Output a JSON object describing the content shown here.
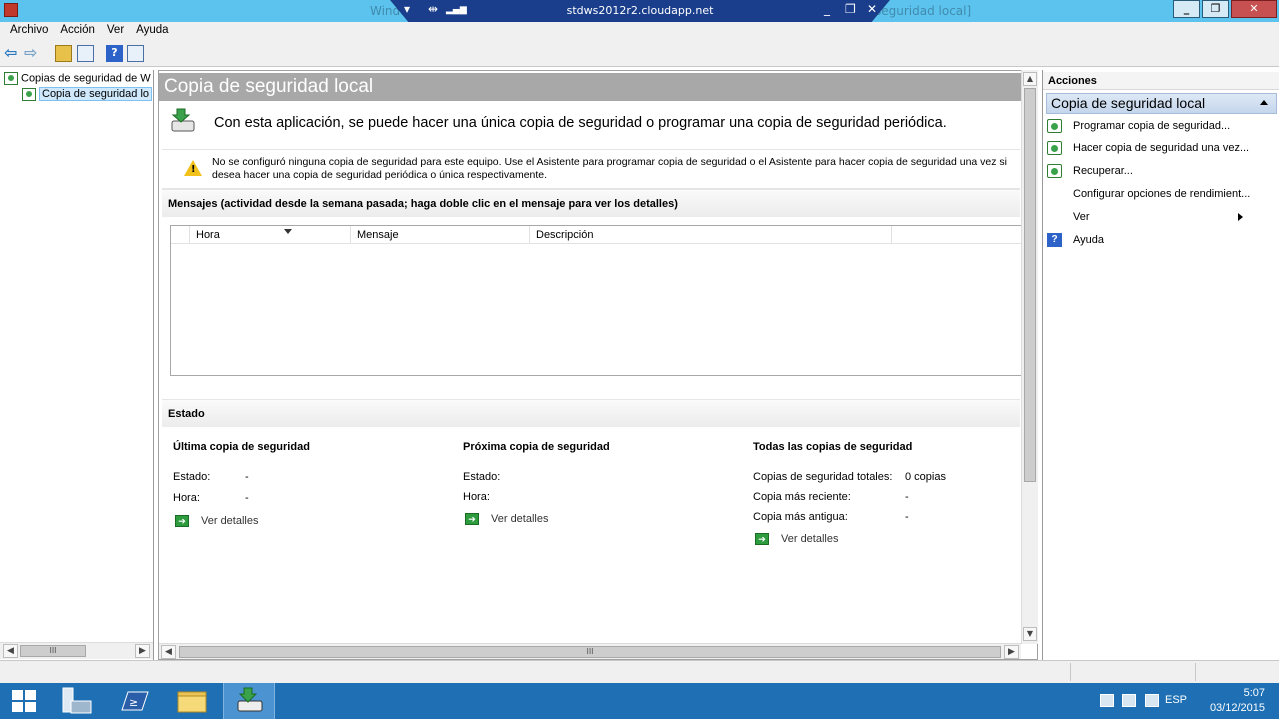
{
  "titlebar": {
    "window_title": "Windows Server Backup - [Copias de seguridad de Windows Server (local)\\Copia de seguridad local]",
    "rdp_host": "stdws2012r2.cloudapp.net",
    "minimize": "_",
    "restore": "❐",
    "close": "✕"
  },
  "menu": [
    "Archivo",
    "Acción",
    "Ver",
    "Ayuda"
  ],
  "tree": {
    "root_label": "Copias de seguridad de W",
    "child_label": "Copia de seguridad lo"
  },
  "center": {
    "header": "Copia de seguridad local",
    "intro": "Con esta aplicación, se puede hacer una única copia de seguridad o programar una copia de seguridad periódica.",
    "warning": "No se configuró ninguna copia de seguridad para este equipo. Use el Asistente para programar copia de seguridad o el Asistente para hacer copia de seguridad una vez si desea hacer una copia de seguridad periódica o única respectivamente.",
    "messages_title": "Mensajes (actividad desde la semana pasada; haga doble clic en el mensaje para ver los detalles)",
    "columns": [
      "Hora",
      "Mensaje",
      "Descripción"
    ],
    "status_title": "Estado",
    "last_backup": {
      "title": "Última copia de seguridad",
      "estado_label": "Estado:",
      "estado_value": "-",
      "hora_label": "Hora:",
      "hora_value": "-",
      "details": "Ver detalles"
    },
    "next_backup": {
      "title": "Próxima copia de seguridad",
      "estado_label": "Estado:",
      "hora_label": "Hora:",
      "details": "Ver detalles"
    },
    "all_backups": {
      "title": "Todas las copias de seguridad",
      "total_label": "Copias de seguridad totales:",
      "total_value": "0 copias",
      "recent_label": "Copia más reciente:",
      "recent_value": "-",
      "oldest_label": "Copia más antigua:",
      "oldest_value": "-",
      "details": "Ver detalles"
    }
  },
  "actions": {
    "title": "Acciones",
    "group": "Copia de seguridad local",
    "items": [
      {
        "label": "Programar copia de seguridad...",
        "icon": "schedule-backup-icon"
      },
      {
        "label": "Hacer copia de seguridad una vez...",
        "icon": "backup-once-icon"
      },
      {
        "label": "Recuperar...",
        "icon": "recover-icon"
      },
      {
        "label": "Configurar opciones de rendimient...",
        "icon": ""
      },
      {
        "label": "Ver",
        "icon": ""
      },
      {
        "label": "Ayuda",
        "icon": "help-icon"
      }
    ]
  },
  "taskbar": {
    "lang": "ESP",
    "time": "5:07",
    "date": "03/12/2015"
  }
}
